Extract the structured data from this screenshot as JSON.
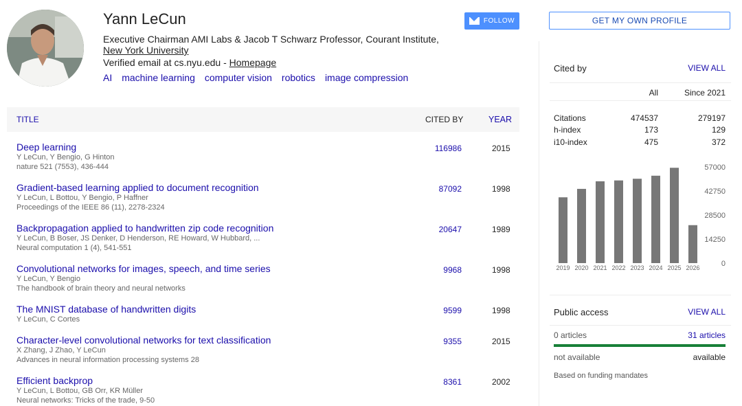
{
  "profile": {
    "name": "Yann LeCun",
    "affiliation_prefix": "Executive Chairman AMI Labs & Jacob T Schwarz Professor, Courant Institute, ",
    "affiliation_link": "New York University",
    "email_text": "Verified email at cs.nyu.edu - ",
    "homepage_label": "Homepage",
    "interests": [
      "AI",
      "machine learning",
      "computer vision",
      "robotics",
      "image compression"
    ],
    "follow_label": "FOLLOW"
  },
  "table": {
    "col_title": "TITLE",
    "col_cited": "CITED BY",
    "col_year": "YEAR",
    "articles": [
      {
        "title": "Deep learning",
        "authors": "Y LeCun, Y Bengio, G Hinton",
        "venue": "nature 521 (7553), 436-444",
        "cited_by": "116986",
        "year": "2015"
      },
      {
        "title": "Gradient-based learning applied to document recognition",
        "authors": "Y LeCun, L Bottou, Y Bengio, P Haffner",
        "venue": "Proceedings of the IEEE 86 (11), 2278-2324",
        "cited_by": "87092",
        "year": "1998"
      },
      {
        "title": "Backpropagation applied to handwritten zip code recognition",
        "authors": "Y LeCun, B Boser, JS Denker, D Henderson, RE Howard, W Hubbard, ...",
        "venue": "Neural computation 1 (4), 541-551",
        "cited_by": "20647",
        "year": "1989"
      },
      {
        "title": "Convolutional networks for images, speech, and time series",
        "authors": "Y LeCun, Y Bengio",
        "venue": "The handbook of brain theory and neural networks",
        "cited_by": "9968",
        "year": "1998"
      },
      {
        "title": "The MNIST database of handwritten digits",
        "authors": "Y LeCun, C Cortes",
        "venue": "",
        "cited_by": "9599",
        "year": "1998"
      },
      {
        "title": "Character-level convolutional networks for text classification",
        "authors": "X Zhang, J Zhao, Y LeCun",
        "venue": "Advances in neural information processing systems 28",
        "cited_by": "9355",
        "year": "2015"
      },
      {
        "title": "Efficient backprop",
        "authors": "Y LeCun, L Bottou, GB Orr, KR Müller",
        "venue": "Neural networks: Tricks of the trade, 9-50",
        "cited_by": "8361",
        "year": "2002"
      }
    ]
  },
  "sidebar": {
    "own_profile_label": "GET MY OWN PROFILE",
    "cited_by_title": "Cited by",
    "view_all_label": "VIEW ALL",
    "col_all": "All",
    "col_since": "Since 2021",
    "metrics": [
      {
        "label": "Citations",
        "all": "474537",
        "since": "279197"
      },
      {
        "label": "h-index",
        "all": "173",
        "since": "129"
      },
      {
        "label": "i10-index",
        "all": "475",
        "since": "372"
      }
    ],
    "public_access_title": "Public access",
    "pa_view_all_label": "VIEW ALL",
    "pa_left": "0 articles",
    "pa_right": "31 articles",
    "pa_not_available": "not available",
    "pa_available": "available",
    "pa_note": "Based on funding mandates",
    "pa_available_fraction": 1.0
  },
  "chart_data": {
    "type": "bar",
    "categories": [
      "2019",
      "2020",
      "2021",
      "2022",
      "2023",
      "2024",
      "2025",
      "2026"
    ],
    "values": [
      39000,
      44000,
      48500,
      49000,
      50000,
      51800,
      56500,
      22500
    ],
    "yticks": [
      0,
      14250,
      28500,
      42750,
      57000
    ],
    "ylim": [
      0,
      57000
    ],
    "bar_color": "#777777"
  }
}
